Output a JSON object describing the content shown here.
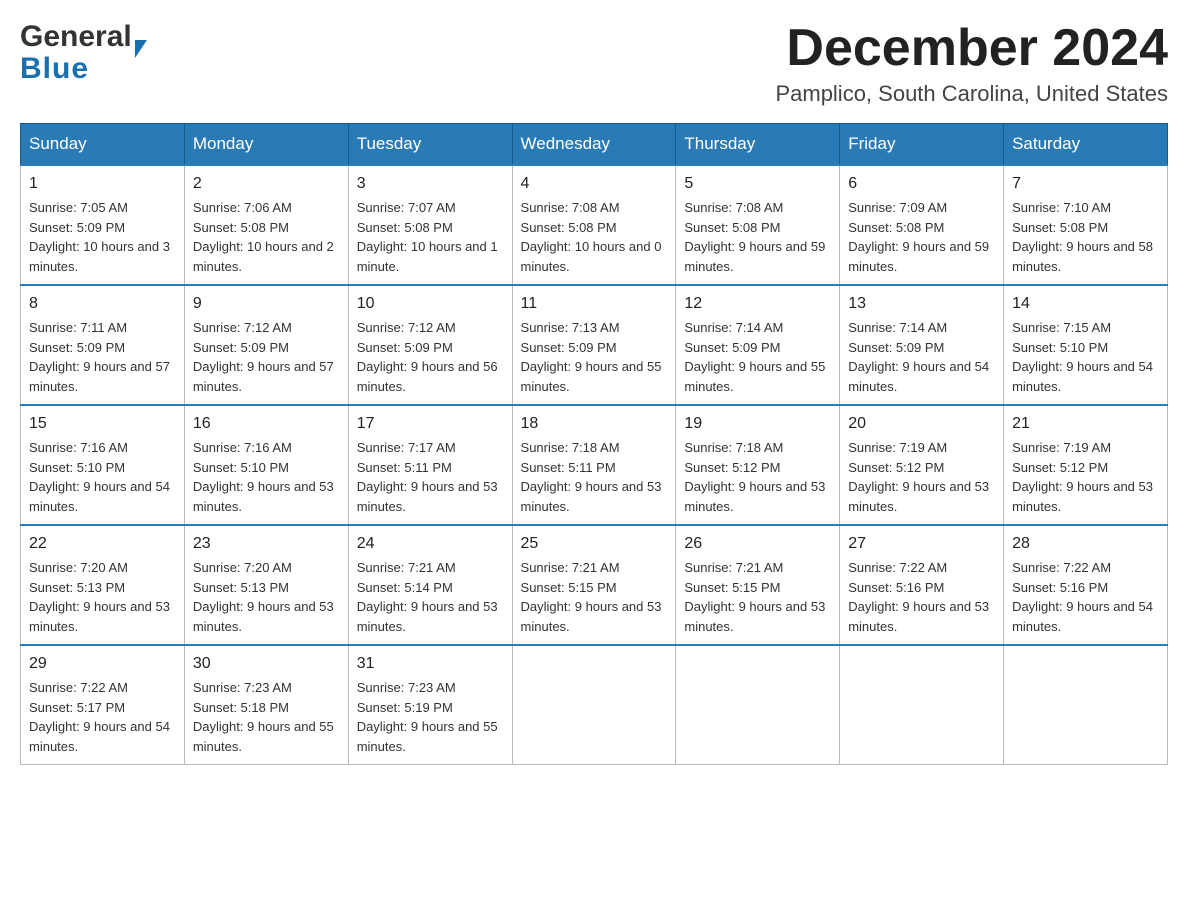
{
  "header": {
    "logo_general": "General",
    "logo_blue": "Blue",
    "month_title": "December 2024",
    "location": "Pamplico, South Carolina, United States"
  },
  "days_of_week": [
    "Sunday",
    "Monday",
    "Tuesday",
    "Wednesday",
    "Thursday",
    "Friday",
    "Saturday"
  ],
  "weeks": [
    [
      {
        "day": "1",
        "sunrise": "7:05 AM",
        "sunset": "5:09 PM",
        "daylight": "10 hours and 3 minutes."
      },
      {
        "day": "2",
        "sunrise": "7:06 AM",
        "sunset": "5:08 PM",
        "daylight": "10 hours and 2 minutes."
      },
      {
        "day": "3",
        "sunrise": "7:07 AM",
        "sunset": "5:08 PM",
        "daylight": "10 hours and 1 minute."
      },
      {
        "day": "4",
        "sunrise": "7:08 AM",
        "sunset": "5:08 PM",
        "daylight": "10 hours and 0 minutes."
      },
      {
        "day": "5",
        "sunrise": "7:08 AM",
        "sunset": "5:08 PM",
        "daylight": "9 hours and 59 minutes."
      },
      {
        "day": "6",
        "sunrise": "7:09 AM",
        "sunset": "5:08 PM",
        "daylight": "9 hours and 59 minutes."
      },
      {
        "day": "7",
        "sunrise": "7:10 AM",
        "sunset": "5:08 PM",
        "daylight": "9 hours and 58 minutes."
      }
    ],
    [
      {
        "day": "8",
        "sunrise": "7:11 AM",
        "sunset": "5:09 PM",
        "daylight": "9 hours and 57 minutes."
      },
      {
        "day": "9",
        "sunrise": "7:12 AM",
        "sunset": "5:09 PM",
        "daylight": "9 hours and 57 minutes."
      },
      {
        "day": "10",
        "sunrise": "7:12 AM",
        "sunset": "5:09 PM",
        "daylight": "9 hours and 56 minutes."
      },
      {
        "day": "11",
        "sunrise": "7:13 AM",
        "sunset": "5:09 PM",
        "daylight": "9 hours and 55 minutes."
      },
      {
        "day": "12",
        "sunrise": "7:14 AM",
        "sunset": "5:09 PM",
        "daylight": "9 hours and 55 minutes."
      },
      {
        "day": "13",
        "sunrise": "7:14 AM",
        "sunset": "5:09 PM",
        "daylight": "9 hours and 54 minutes."
      },
      {
        "day": "14",
        "sunrise": "7:15 AM",
        "sunset": "5:10 PM",
        "daylight": "9 hours and 54 minutes."
      }
    ],
    [
      {
        "day": "15",
        "sunrise": "7:16 AM",
        "sunset": "5:10 PM",
        "daylight": "9 hours and 54 minutes."
      },
      {
        "day": "16",
        "sunrise": "7:16 AM",
        "sunset": "5:10 PM",
        "daylight": "9 hours and 53 minutes."
      },
      {
        "day": "17",
        "sunrise": "7:17 AM",
        "sunset": "5:11 PM",
        "daylight": "9 hours and 53 minutes."
      },
      {
        "day": "18",
        "sunrise": "7:18 AM",
        "sunset": "5:11 PM",
        "daylight": "9 hours and 53 minutes."
      },
      {
        "day": "19",
        "sunrise": "7:18 AM",
        "sunset": "5:12 PM",
        "daylight": "9 hours and 53 minutes."
      },
      {
        "day": "20",
        "sunrise": "7:19 AM",
        "sunset": "5:12 PM",
        "daylight": "9 hours and 53 minutes."
      },
      {
        "day": "21",
        "sunrise": "7:19 AM",
        "sunset": "5:12 PM",
        "daylight": "9 hours and 53 minutes."
      }
    ],
    [
      {
        "day": "22",
        "sunrise": "7:20 AM",
        "sunset": "5:13 PM",
        "daylight": "9 hours and 53 minutes."
      },
      {
        "day": "23",
        "sunrise": "7:20 AM",
        "sunset": "5:13 PM",
        "daylight": "9 hours and 53 minutes."
      },
      {
        "day": "24",
        "sunrise": "7:21 AM",
        "sunset": "5:14 PM",
        "daylight": "9 hours and 53 minutes."
      },
      {
        "day": "25",
        "sunrise": "7:21 AM",
        "sunset": "5:15 PM",
        "daylight": "9 hours and 53 minutes."
      },
      {
        "day": "26",
        "sunrise": "7:21 AM",
        "sunset": "5:15 PM",
        "daylight": "9 hours and 53 minutes."
      },
      {
        "day": "27",
        "sunrise": "7:22 AM",
        "sunset": "5:16 PM",
        "daylight": "9 hours and 53 minutes."
      },
      {
        "day": "28",
        "sunrise": "7:22 AM",
        "sunset": "5:16 PM",
        "daylight": "9 hours and 54 minutes."
      }
    ],
    [
      {
        "day": "29",
        "sunrise": "7:22 AM",
        "sunset": "5:17 PM",
        "daylight": "9 hours and 54 minutes."
      },
      {
        "day": "30",
        "sunrise": "7:23 AM",
        "sunset": "5:18 PM",
        "daylight": "9 hours and 55 minutes."
      },
      {
        "day": "31",
        "sunrise": "7:23 AM",
        "sunset": "5:19 PM",
        "daylight": "9 hours and 55 minutes."
      },
      null,
      null,
      null,
      null
    ]
  ]
}
